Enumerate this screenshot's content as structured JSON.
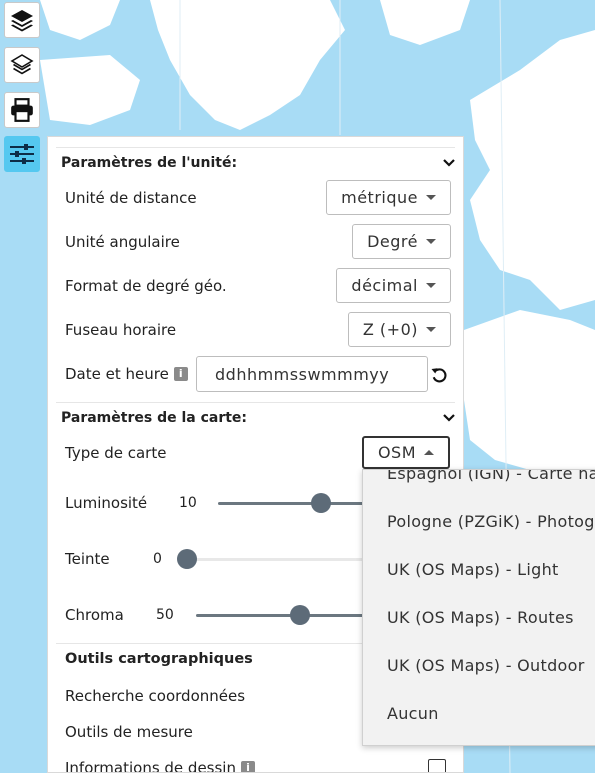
{
  "colors": {
    "water": "#a8dcf5",
    "land": "#ffffff",
    "accent": "#55c8f0",
    "slider": "#5d6b78"
  },
  "toolbar": [
    {
      "name": "layers-icon"
    },
    {
      "name": "layers-outline-icon"
    },
    {
      "name": "print-icon"
    },
    {
      "name": "sliders-icon",
      "active": true
    }
  ],
  "unit_section": {
    "title": "Paramètres de l'unité:",
    "rows": [
      {
        "label": "Unité de distance",
        "value": "métrique"
      },
      {
        "label": "Unité angulaire",
        "value": "Degré"
      },
      {
        "label": "Format de degré géo.",
        "value": "décimal"
      },
      {
        "label": "Fuseau horaire",
        "value": "Z (+0)"
      }
    ],
    "datetime_label": "Date et heure",
    "datetime_value": "ddhhmmsswmmmyy"
  },
  "map_section": {
    "title": "Paramètres de la carte:",
    "map_type_label": "Type de carte",
    "map_type_value": "OSM",
    "sliders": [
      {
        "label": "Luminosité",
        "value": "10",
        "level": 0.65
      },
      {
        "label": "Teinte",
        "value": "0",
        "level": 0.0
      },
      {
        "label": "Chroma",
        "value": "50",
        "level": 0.5
      }
    ]
  },
  "tools_section": {
    "title": "Outils cartographiques",
    "items": [
      "Recherche coordonnées",
      "Outils de mesure",
      "Informations de dessin"
    ]
  },
  "dropdown": {
    "options": [
      "Espagnol (IGN) - Carte nat",
      "Pologne (PZGiK) - Photogr",
      "UK (OS Maps) - Light",
      "UK (OS Maps) - Routes",
      "UK (OS Maps) - Outdoor",
      "Aucun"
    ]
  }
}
